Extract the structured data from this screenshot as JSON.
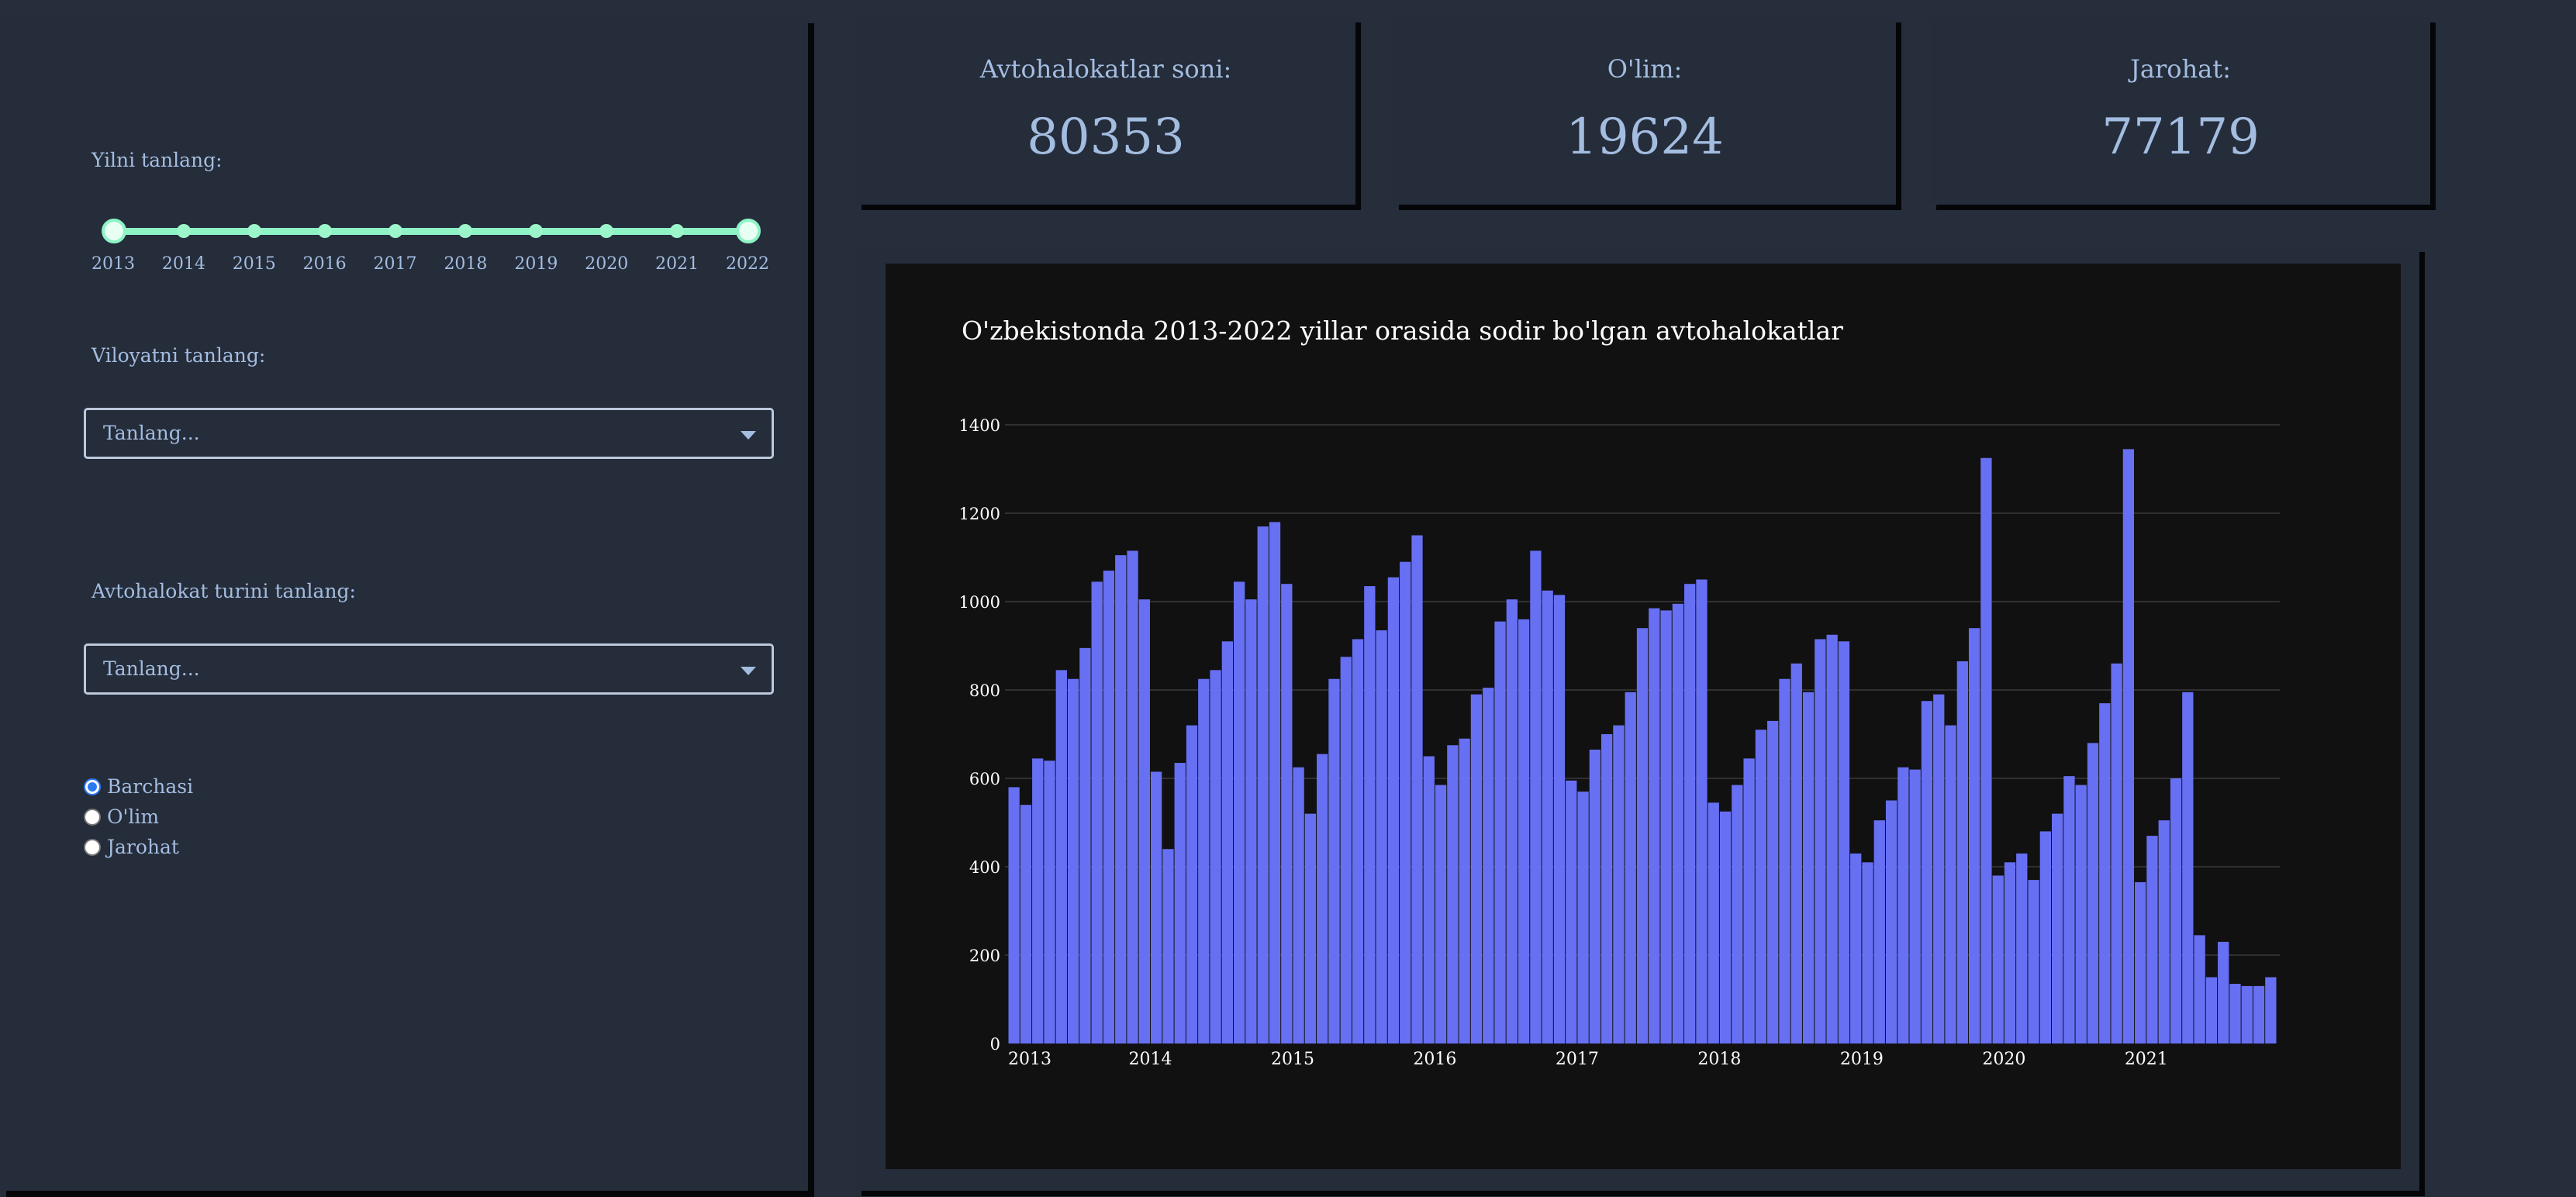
{
  "sidebar": {
    "year_label": "Yilni tanlang:",
    "years": [
      "2013",
      "2014",
      "2015",
      "2016",
      "2017",
      "2018",
      "2019",
      "2020",
      "2021",
      "2022"
    ],
    "year_range": [
      "2013",
      "2022"
    ],
    "region_label": "Viloyatni tanlang:",
    "region_placeholder": "Tanlang...",
    "type_label": "Avtohalokat turini tanlang:",
    "type_placeholder": "Tanlang...",
    "radio_options": [
      "Barchasi",
      "O'lim",
      "Jarohat"
    ],
    "radio_selected": "Barchasi"
  },
  "cards": [
    {
      "title": "Avtohalokatlar soni:",
      "value": "80353"
    },
    {
      "title": "O'lim:",
      "value": "19624"
    },
    {
      "title": "Jarohat:",
      "value": "77179"
    }
  ],
  "colors": {
    "background": "#262d3b",
    "panel": "#252c3a",
    "accent_text": "#a3bde0",
    "slider": "#8ef3c5",
    "bar": "#6770f2",
    "chart_bg": "#111111"
  },
  "chart_data": {
    "type": "bar",
    "title": "O'zbekistonda 2013-2022 yillar orasida sodir bo'lgan avtohalokatlar",
    "xlabel": "",
    "ylabel": "",
    "ylim": [
      0,
      1400
    ],
    "yticks": [
      0,
      200,
      400,
      600,
      800,
      1000,
      1200,
      1400
    ],
    "grid": true,
    "x_start": "2013",
    "x_ticks": [
      "2013",
      "2014",
      "2015",
      "2016",
      "2017",
      "2018",
      "2019",
      "2020",
      "2021"
    ],
    "values": [
      580,
      540,
      645,
      640,
      845,
      825,
      895,
      1045,
      1070,
      1105,
      1115,
      1005,
      615,
      440,
      635,
      720,
      825,
      845,
      910,
      1045,
      1005,
      1170,
      1180,
      1040,
      625,
      520,
      655,
      825,
      875,
      915,
      1035,
      935,
      1055,
      1090,
      1150,
      650,
      585,
      675,
      690,
      790,
      805,
      955,
      1005,
      960,
      1115,
      1025,
      1015,
      595,
      570,
      665,
      700,
      720,
      795,
      940,
      985,
      980,
      995,
      1040,
      1050,
      545,
      525,
      585,
      645,
      710,
      730,
      825,
      860,
      795,
      915,
      925,
      910,
      430,
      410,
      505,
      550,
      625,
      620,
      775,
      790,
      720,
      865,
      940,
      1325,
      380,
      410,
      430,
      370,
      480,
      520,
      605,
      585,
      680,
      770,
      860,
      1345,
      365,
      470,
      505,
      600,
      795,
      245,
      150,
      230,
      135,
      130,
      130,
      150
    ]
  }
}
